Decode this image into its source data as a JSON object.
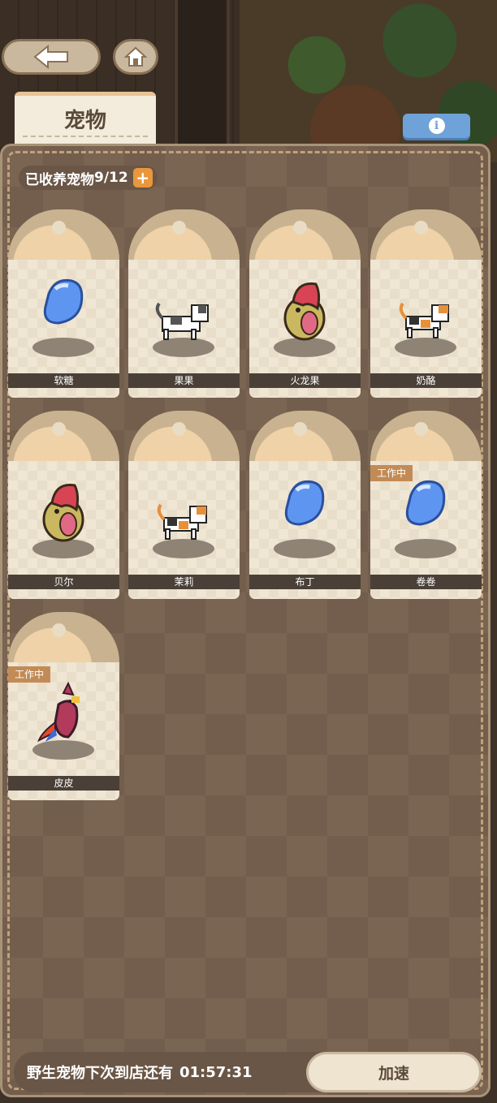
{
  "header": {
    "title": "宠物"
  },
  "count": {
    "label": "已收养宠物",
    "value": "9/12",
    "plus": "+"
  },
  "pets": [
    {
      "name": "软糖",
      "type": "slime"
    },
    {
      "name": "果果",
      "type": "cat-white"
    },
    {
      "name": "火龙果",
      "type": "bird-red"
    },
    {
      "name": "奶酪",
      "type": "cat-calico"
    },
    {
      "name": "贝尔",
      "type": "bird-red"
    },
    {
      "name": "茉莉",
      "type": "cat-calico"
    },
    {
      "name": "布丁",
      "type": "slime"
    },
    {
      "name": "卷卷",
      "type": "slime",
      "badge": "工作中"
    },
    {
      "name": "皮皮",
      "type": "parrot",
      "badge": "工作中"
    }
  ],
  "footer": {
    "timer_label": "野生宠物下次到店还有",
    "timer_value": "01:57:31",
    "speed_label": "加速"
  }
}
